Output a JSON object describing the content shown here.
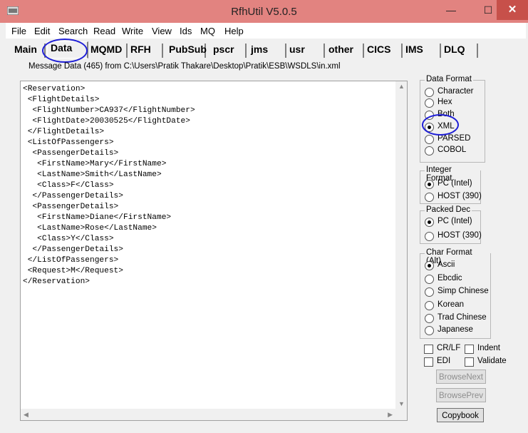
{
  "window": {
    "title": "RfhUtil V5.0.5",
    "min": "—",
    "max": "☐",
    "close": "✕"
  },
  "menu": [
    "File",
    "Edit",
    "Search",
    "Read",
    "Write",
    "View",
    "Ids",
    "MQ",
    "Help"
  ],
  "tabs": [
    "Main",
    "Data",
    "MQMD",
    "RFH",
    "PubSub",
    "pscr",
    "jms",
    "usr",
    "other",
    "CICS",
    "IMS",
    "DLQ"
  ],
  "active_tab": "Data",
  "message_info": "Message Data (465) from C:\\Users\\Pratik Thakare\\Desktop\\Pratik\\ESB\\WSDLS\\in.xml",
  "xml_lines": [
    "<Reservation>",
    " <FlightDetails>",
    "  <FlightNumber>CA937</FlightNumber>",
    "  <FlightDate>20030525</FlightDate>",
    " </FlightDetails>",
    " <ListOfPassengers>",
    "  <PassengerDetails>",
    "   <FirstName>Mary</FirstName>",
    "   <LastName>Smith</LastName>",
    "   <Class>F</Class>",
    "  </PassengerDetails>",
    "  <PassengerDetails>",
    "   <FirstName>Diane</FirstName>",
    "   <LastName>Rose</LastName>",
    "   <Class>Y</Class>",
    "  </PassengerDetails>",
    " </ListOfPassengers>",
    " <Request>M</Request>",
    "</Reservation>"
  ],
  "data_format": {
    "label": "Data Format",
    "options": [
      "Character",
      "Hex",
      "Both",
      "XML",
      "PARSED",
      "COBOL"
    ],
    "selected": "XML"
  },
  "integer_format": {
    "label": "Integer Format",
    "options": [
      "PC (Intel)",
      "HOST (390)"
    ],
    "selected": "PC (Intel)"
  },
  "packed_dec": {
    "label": "Packed Dec",
    "options": [
      "PC (Intel)",
      "HOST (390)"
    ],
    "selected": "PC (Intel)"
  },
  "char_format": {
    "label": "Char Format (Alt)",
    "options": [
      "Ascii",
      "Ebcdic",
      "Simp Chinese",
      "Korean",
      "Trad Chinese",
      "Japanese"
    ],
    "selected": "Ascii"
  },
  "checkboxes": {
    "crlf": "CR/LF",
    "indent": "Indent",
    "edi": "EDI",
    "validate": "Validate"
  },
  "buttons": {
    "browse_next": "BrowseNext",
    "browse_prev": "BrowsePrev",
    "copybook": "Copybook"
  },
  "colors": {
    "titlebar": "#e28380",
    "close": "#c7504a",
    "annotation": "#1f1fd6"
  }
}
